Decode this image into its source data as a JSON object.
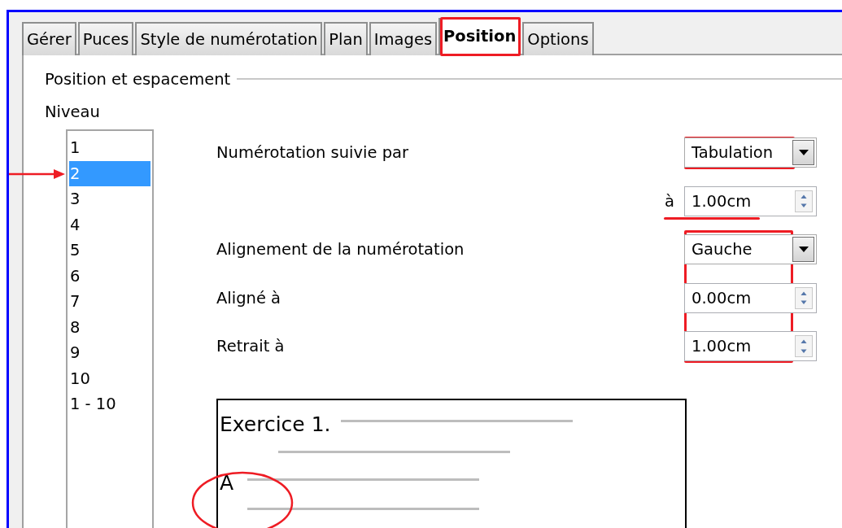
{
  "tabs": [
    {
      "label": "Gérer",
      "selected": false,
      "highlighted": false
    },
    {
      "label": "Puces",
      "selected": false,
      "highlighted": false
    },
    {
      "label": "Style de numérotation",
      "selected": false,
      "highlighted": false
    },
    {
      "label": "Plan",
      "selected": false,
      "highlighted": false
    },
    {
      "label": "Images",
      "selected": false,
      "highlighted": false
    },
    {
      "label": "Position",
      "selected": true,
      "highlighted": true
    },
    {
      "label": "Options",
      "selected": false,
      "highlighted": false
    }
  ],
  "group": {
    "title": "Position et espacement"
  },
  "levels": {
    "label": "Niveau",
    "items": [
      {
        "label": "1",
        "selected": false,
        "pointed": false
      },
      {
        "label": "2",
        "selected": true,
        "pointed": true
      },
      {
        "label": "3",
        "selected": false,
        "pointed": false
      },
      {
        "label": "4",
        "selected": false,
        "pointed": false
      },
      {
        "label": "5",
        "selected": false,
        "pointed": false
      },
      {
        "label": "6",
        "selected": false,
        "pointed": false
      },
      {
        "label": "7",
        "selected": false,
        "pointed": false
      },
      {
        "label": "8",
        "selected": false,
        "pointed": false
      },
      {
        "label": "9",
        "selected": false,
        "pointed": false
      },
      {
        "label": "10",
        "selected": false,
        "pointed": false
      },
      {
        "label": "1 - 10",
        "selected": false,
        "pointed": false
      }
    ]
  },
  "rows": [
    {
      "kind": "select",
      "label": "Numérotation suivie par",
      "value": "Tabulation",
      "highlighted": true,
      "underlined": false
    },
    {
      "kind": "inline_spin",
      "label": "à",
      "value": "1.00cm",
      "highlighted": false,
      "underlined": true
    },
    {
      "kind": "select",
      "label": "Alignement de la numérotation",
      "value": "Gauche",
      "highlighted": true,
      "underlined": false
    },
    {
      "kind": "spin",
      "label": "Aligné à",
      "value": "0.00cm",
      "highlighted": true,
      "underlined": false
    },
    {
      "kind": "spin",
      "label": "Retrait à",
      "value": "1.00cm",
      "highlighted": true,
      "underlined": false
    }
  ],
  "preview": {
    "heading": "Exercice 1.",
    "item": "A",
    "circled": true
  }
}
